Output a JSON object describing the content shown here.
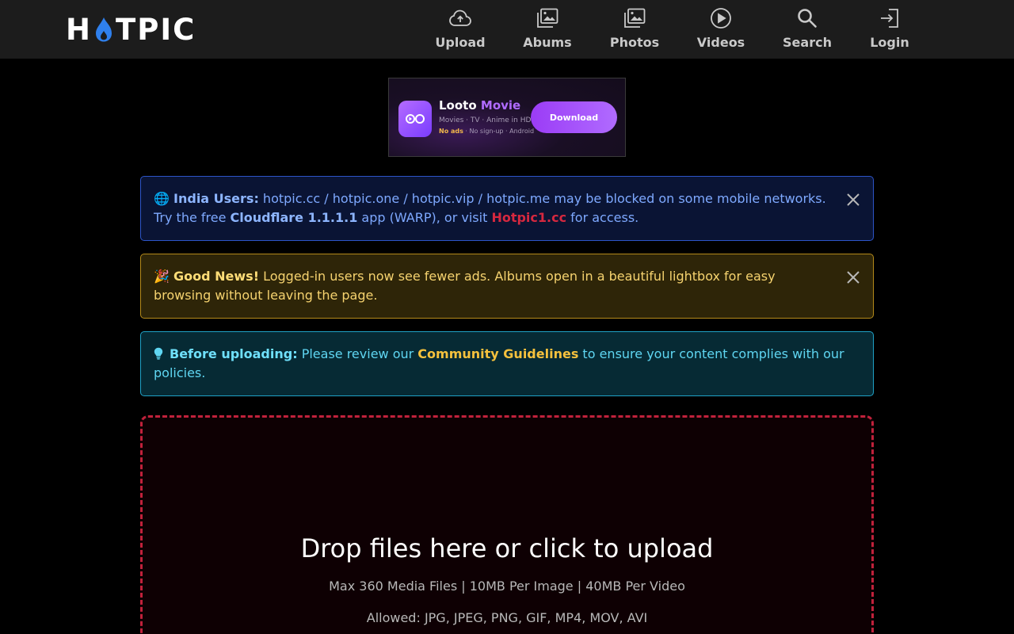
{
  "brand": {
    "logo_left": "H",
    "logo_right": "TPIC",
    "flame_color": "#2f80ed"
  },
  "nav": [
    {
      "label": "Upload",
      "icon": "cloud-upload-icon"
    },
    {
      "label": "Abums",
      "icon": "album-icon"
    },
    {
      "label": "Photos",
      "icon": "photo-icon"
    },
    {
      "label": "Videos",
      "icon": "play-circle-icon"
    },
    {
      "label": "Search",
      "icon": "search-icon"
    },
    {
      "label": "Login",
      "icon": "login-icon"
    }
  ],
  "ad": {
    "app_name": "Looto",
    "app_name_accent": "Movie",
    "tagline": "Movies · TV · Anime in HD",
    "badge": "No ads",
    "details": " · No sign-up · Android",
    "button": "Download"
  },
  "alerts": {
    "india": {
      "emoji": "🌐",
      "title": "India Users:",
      "text1": " hotpic.cc / hotpic.one / hotpic.vip / hotpic.me may be blocked on some mobile networks. Try the free ",
      "cloudflare": "Cloudflare 1.1.1.1",
      "text2": " app (WARP), or visit ",
      "link": "Hotpic1.cc",
      "text3": " for access."
    },
    "news": {
      "emoji": "🎉",
      "title": "Good News!",
      "text": " Logged-in users now see fewer ads. Albums open in a beautiful lightbox for easy browsing without leaving the page."
    },
    "info": {
      "title": "Before uploading:",
      "text1": " Please review our ",
      "link": "Community Guidelines",
      "text2": " to ensure your content complies with our policies."
    }
  },
  "dropzone": {
    "title": "Drop files here or click to upload",
    "limits": "Max 360 Media Files | 10MB Per Image | 40MB Per Video",
    "allowed": "Allowed: JPG, JPEG, PNG, GIF, MP4, MOV, AVI"
  },
  "colors": {
    "header_bg": "#1c1c1c",
    "india_border": "#2d55c8",
    "news_border": "#b48a1a",
    "info_border": "#1fa2c7",
    "drop_border": "#c0213b"
  }
}
